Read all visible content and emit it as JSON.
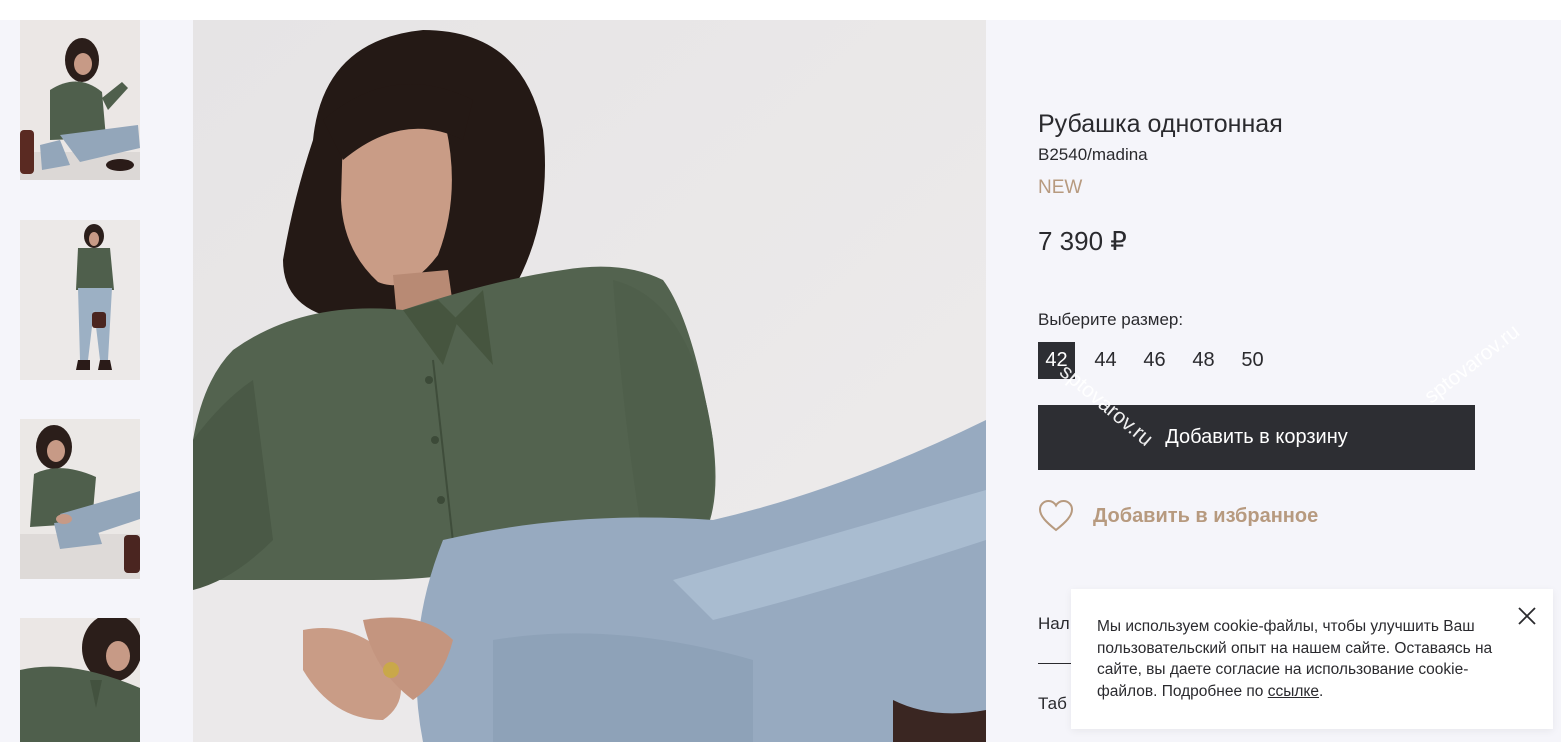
{
  "product": {
    "title": "Рубашка однотонная",
    "sku": "B2540/madina",
    "badge": "NEW",
    "price": "7 390 ₽"
  },
  "sizes": {
    "label": "Выберите размер:",
    "options": [
      "42",
      "44",
      "46",
      "48",
      "50"
    ],
    "selected": "42"
  },
  "actions": {
    "add_to_cart": "Добавить в корзину",
    "add_to_favorites": "Добавить в избранное"
  },
  "sections": {
    "details_partial": "Нал",
    "table_partial": "Таб"
  },
  "cookie": {
    "text": "Мы используем cookie-файлы, чтобы улучшить Ваш пользовательский опыт на нашем сайте. Оставаясь на сайте, вы даете согласие на использование cookie-файлов. Подробнее по ",
    "link_text": "ссылке",
    "end": "."
  },
  "watermarks": [
    "sptovarov.ru",
    "sptovarov.ru"
  ],
  "colors": {
    "accent": "#b79a7f",
    "dark_button": "#2d2e33",
    "background": "#f5f5fa"
  },
  "icons": {
    "favorite": "heart-outline-icon",
    "close": "close-x-icon"
  }
}
